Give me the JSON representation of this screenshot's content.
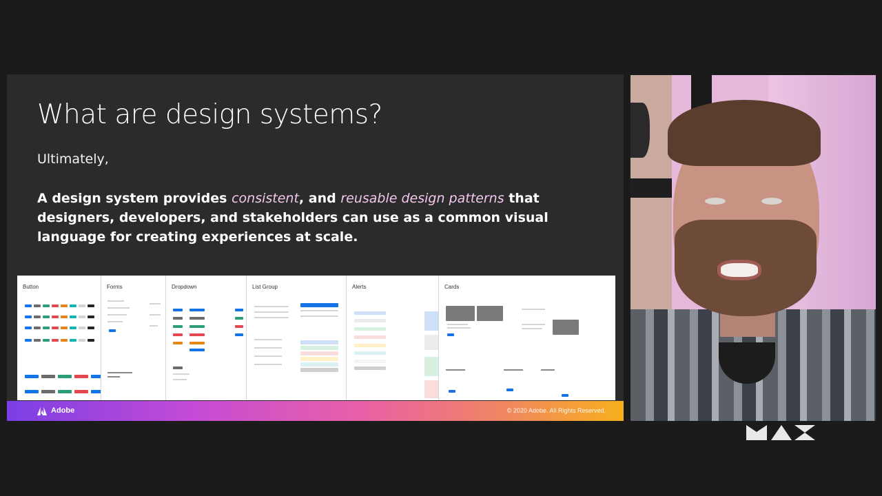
{
  "slide": {
    "title": "What are design systems?",
    "lead": "Ultimately,",
    "body": {
      "part1": "A design system provides ",
      "em1": "consistent",
      "part2": ", and ",
      "em2": "reusable design patterns",
      "part3": " that designers, developers, and stakeholders can use as a common visual language for creating experiences at scale."
    },
    "panels": [
      {
        "title": "Button"
      },
      {
        "title": "Forms"
      },
      {
        "title": "Dropdown"
      },
      {
        "title": "List Group"
      },
      {
        "title": "Alerts"
      },
      {
        "title": "Cards"
      }
    ],
    "footer": {
      "brand": "Adobe",
      "copyright": "© 2020 Adobe. All Rights Reserved."
    }
  },
  "colors": {
    "slide_bg": "#2b2b2b",
    "emphasis": "#f3c8ee",
    "gradient_start": "#7b3fe4",
    "gradient_end": "#f7b01c"
  },
  "icons": {
    "brand": "adobe-logo-icon",
    "event": "max-logo-icon"
  }
}
